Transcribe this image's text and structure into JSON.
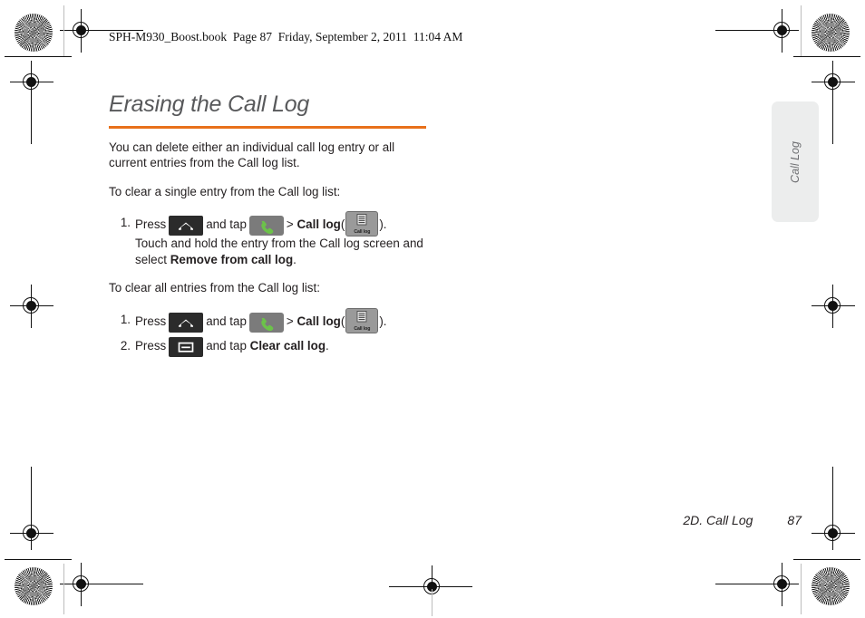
{
  "header": {
    "text": "SPH-M930_Boost.book  Page 87  Friday, September 2, 2011  11:04 AM"
  },
  "title": "Erasing the Call Log",
  "intro": "You can delete either an individual call log entry or all current entries from the Call log list.",
  "sections": [
    {
      "lead_in": "To clear a single entry from the Call log list:",
      "steps": [
        {
          "number": "1.",
          "press_label": "Press",
          "and_tap_label": "and tap",
          "separator": ">",
          "target_bold": "Call log",
          "open_paren": "(",
          "close_paren": ").",
          "sub_text_before": "Touch and hold the entry from the Call log screen and select ",
          "sub_text_bold": "Remove from call log",
          "sub_text_after": "."
        }
      ]
    },
    {
      "lead_in": "To clear all entries from the Call log list:",
      "steps": [
        {
          "number": "1.",
          "press_label": "Press",
          "and_tap_label": "and tap",
          "separator": ">",
          "target_bold": "Call log",
          "open_paren": "(",
          "close_paren": ")."
        },
        {
          "number": "2.",
          "press_label": "Press",
          "and_tap_label": "and tap",
          "target_bold": "Clear call log",
          "after": "."
        }
      ]
    }
  ],
  "icons": {
    "home": "home-button-icon",
    "phone": "phone-button-icon",
    "call_log_tab": "call-log-tab-icon",
    "call_log_tab_label": "Call log",
    "menu": "menu-button-icon"
  },
  "side_tab": {
    "label": "Call Log"
  },
  "footer": {
    "chapter": "2D. Call Log",
    "page_number": "87"
  },
  "colors": {
    "accent_rule": "#E8701A",
    "title_text": "#58595b",
    "body_text": "#231f20",
    "icon_dark": "#2b2b2b",
    "icon_gray": "#7b7b7b",
    "phone_green": "#6cc24a",
    "side_tab_bg": "#eceded"
  }
}
